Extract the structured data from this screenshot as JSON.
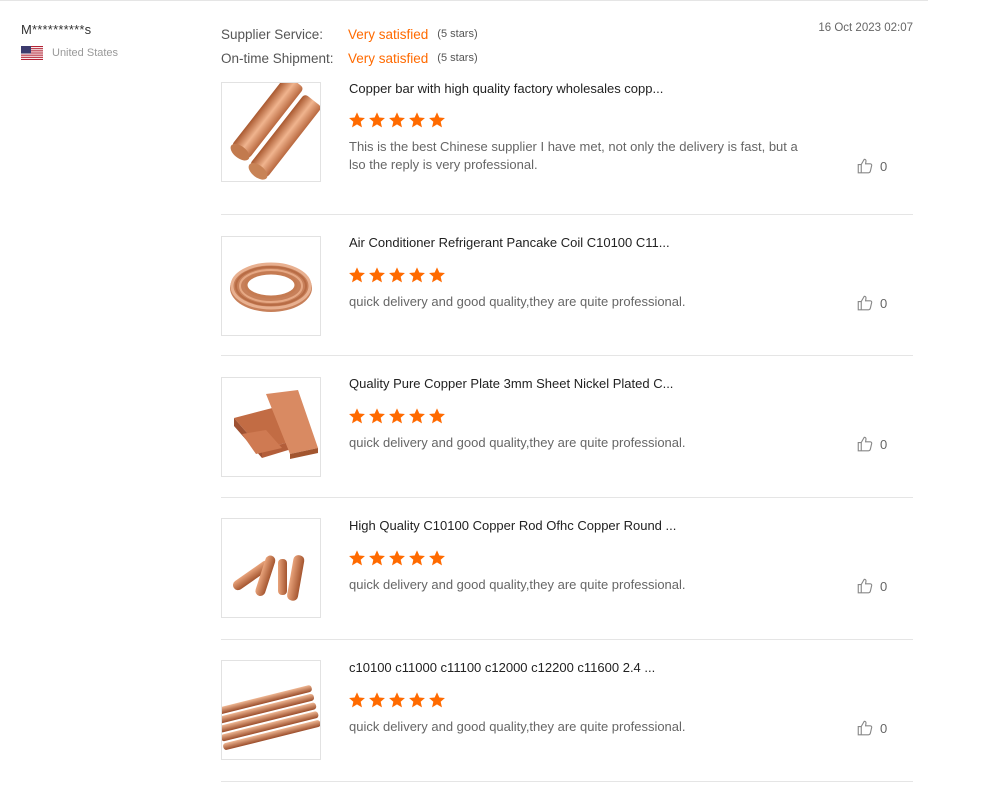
{
  "reviewer": {
    "name": "M**********s",
    "country": "United States"
  },
  "ratings": [
    {
      "label": "Supplier Service:",
      "value": "Very satisfied",
      "stars": "(5 stars)"
    },
    {
      "label": "On-time Shipment:",
      "value": "Very satisfied",
      "stars": "(5 stars)"
    }
  ],
  "review_date": "16 Oct 2023 02:07",
  "colors": {
    "accent": "#ff6a00",
    "star": "#ff6a00",
    "copper": "#d0805a"
  },
  "items": [
    {
      "title": "Copper bar with high quality factory wholesales copp...",
      "rating": 5,
      "comment": "This is the best Chinese supplier I have met, not only the delivery is fast, but also the reply is very professional.",
      "likes": "0",
      "thumb_icon": "copper-bar-image"
    },
    {
      "title": "Air Conditioner Refrigerant Pancake Coil C10100 C11...",
      "rating": 5,
      "comment": "quick delivery and good quality,they are quite professional.",
      "likes": "0",
      "thumb_icon": "copper-coil-image"
    },
    {
      "title": "Quality Pure Copper Plate 3mm Sheet Nickel Plated C...",
      "rating": 5,
      "comment": "quick delivery and good quality,they are quite professional.",
      "likes": "0",
      "thumb_icon": "copper-plate-image"
    },
    {
      "title": "High Quality C10100 Copper Rod Ofhc Copper Round ...",
      "rating": 5,
      "comment": "quick delivery and good quality,they are quite professional.",
      "likes": "0",
      "thumb_icon": "copper-rod-image"
    },
    {
      "title": "c10100 c11000 c11100 c12000 c12200 c11600 2.4 ...",
      "rating": 5,
      "comment": "quick delivery and good quality,they are quite professional.",
      "likes": "0",
      "thumb_icon": "copper-bars-bundle-image"
    }
  ]
}
